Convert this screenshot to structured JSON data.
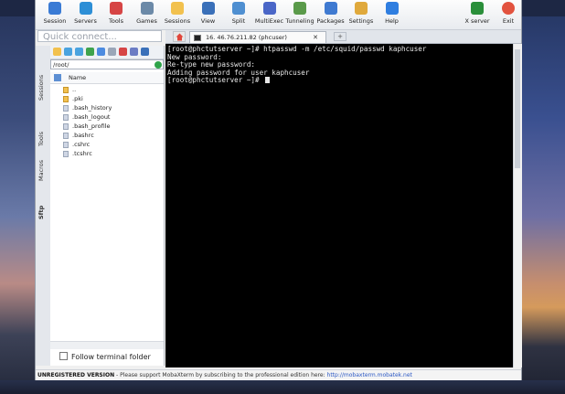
{
  "toolbar": {
    "items": [
      {
        "label": "Session",
        "color": "#3a7bd5"
      },
      {
        "label": "Servers",
        "color": "#2d8fd6"
      },
      {
        "label": "Tools",
        "color": "#d64545"
      },
      {
        "label": "Games",
        "color": "#6c8aa8"
      },
      {
        "label": "Sessions",
        "color": "#f2c14e"
      },
      {
        "label": "View",
        "color": "#3a70b9"
      },
      {
        "label": "Split",
        "color": "#4f8fd1"
      },
      {
        "label": "MultiExec",
        "color": "#4a66c7"
      },
      {
        "label": "Tunneling",
        "color": "#5a9a4a"
      },
      {
        "label": "Packages",
        "color": "#3f7ad1"
      },
      {
        "label": "Settings",
        "color": "#e0a93c"
      },
      {
        "label": "Help",
        "color": "#2f7ee0"
      }
    ],
    "xserver_label": "X server",
    "exit_label": "Exit"
  },
  "quick_connect": {
    "placeholder": "Quick connect..."
  },
  "side_tabs": [
    "Sessions",
    "Tools",
    "Macros",
    "Sftp"
  ],
  "sftp": {
    "path": "/root/",
    "column_name": "Name",
    "files": [
      {
        "name": "..",
        "dir": true
      },
      {
        "name": ".pki",
        "dir": true
      },
      {
        "name": ".bash_history",
        "dir": false
      },
      {
        "name": ".bash_logout",
        "dir": false
      },
      {
        "name": ".bash_profile",
        "dir": false
      },
      {
        "name": ".bashrc",
        "dir": false
      },
      {
        "name": ".cshrc",
        "dir": false
      },
      {
        "name": ".tcshrc",
        "dir": false
      }
    ],
    "follow_label": "Follow terminal folder"
  },
  "tab": {
    "title": "16. 46.76.211.82 (phcuser)"
  },
  "terminal": {
    "lines": [
      "[root@phctutserver ~]# htpasswd -m /etc/squid/passwd kaphcuser",
      "New password:",
      "Re-type new password:",
      "Adding password for user kaphcuser",
      "[root@phctutserver ~]# "
    ]
  },
  "status": {
    "unregistered": "UNREGISTERED VERSION",
    "message": " - Please support MobaXterm by subscribing to the professional edition here: ",
    "link": "http://mobaxterm.mobatek.net"
  }
}
